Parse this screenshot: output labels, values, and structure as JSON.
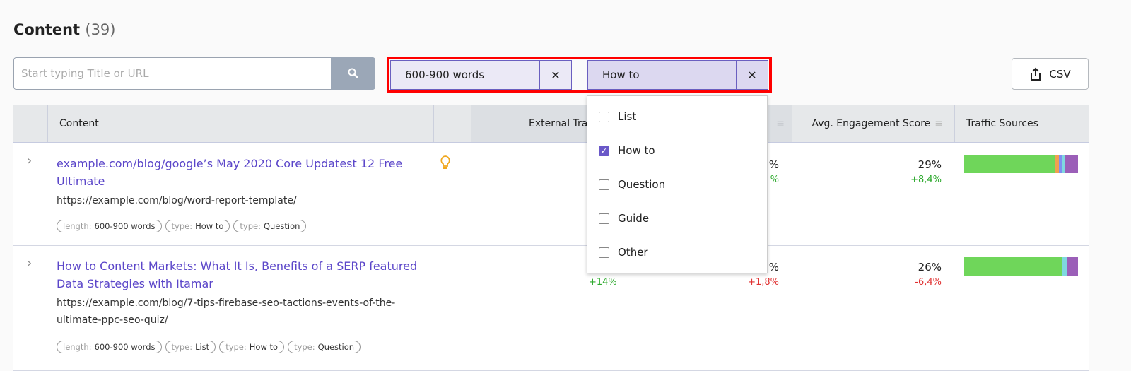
{
  "header": {
    "title": "Content",
    "count": "(39)"
  },
  "search": {
    "placeholder": "Start typing Title or URL",
    "value": ""
  },
  "filters": [
    {
      "label": "600-900 words"
    },
    {
      "label": "How to"
    }
  ],
  "csv_label": "CSV",
  "table": {
    "columns": [
      "Content",
      "External Tra",
      "Avg. Engagement Score",
      "Traffic Sources"
    ]
  },
  "dropdown": {
    "options": [
      {
        "label": "List",
        "checked": false
      },
      {
        "label": "How to",
        "checked": true
      },
      {
        "label": "Question",
        "checked": false
      },
      {
        "label": "Guide",
        "checked": false
      },
      {
        "label": "Other",
        "checked": false
      }
    ]
  },
  "rows": [
    {
      "title": "example.com/blog/google’s May 2020 Core Updatest 12 Free Ultimate",
      "url": "https://example.com/blog/word-report-template/",
      "tags": [
        {
          "k": "length:",
          "v": "600-900 words"
        },
        {
          "k": "type:",
          "v": "How to"
        },
        {
          "k": "type:",
          "v": "Question"
        }
      ],
      "ext_value": "",
      "ext_delta": "",
      "col2_value": "%",
      "col2_delta": "%",
      "eng_value": "29%",
      "eng_delta": "+8,4%",
      "traffic": [
        {
          "color": "#6fd65a",
          "share": 80
        },
        {
          "color": "#f0a050",
          "share": 3
        },
        {
          "color": "#7f8ff0",
          "share": 3
        },
        {
          "color": "#7fd8e0",
          "share": 3
        },
        {
          "color": "#9b5fb8",
          "share": 11
        }
      ]
    },
    {
      "title": "How to Content Markets: What It Is, Benefits of a SERP featured Data Strategies with Itamar",
      "url": "https://example.com/blog/7-tips-firebase-seo-tactions-events-of-the-ultimate-ppc-seo-quiz/",
      "tags": [
        {
          "k": "length:",
          "v": "600-900 words"
        },
        {
          "k": "type:",
          "v": "List"
        },
        {
          "k": "type:",
          "v": "How to"
        },
        {
          "k": "type:",
          "v": "Question"
        }
      ],
      "ext_value": "",
      "ext_delta": "+14%",
      "col2_value": "%",
      "col2_delta": "+1,8%",
      "eng_value": "26%",
      "eng_delta": "-6,4%",
      "traffic": [
        {
          "color": "#6fd65a",
          "share": 86
        },
        {
          "color": "#7fd8e0",
          "share": 4
        },
        {
          "color": "#9b5fb8",
          "share": 10
        }
      ]
    }
  ]
}
